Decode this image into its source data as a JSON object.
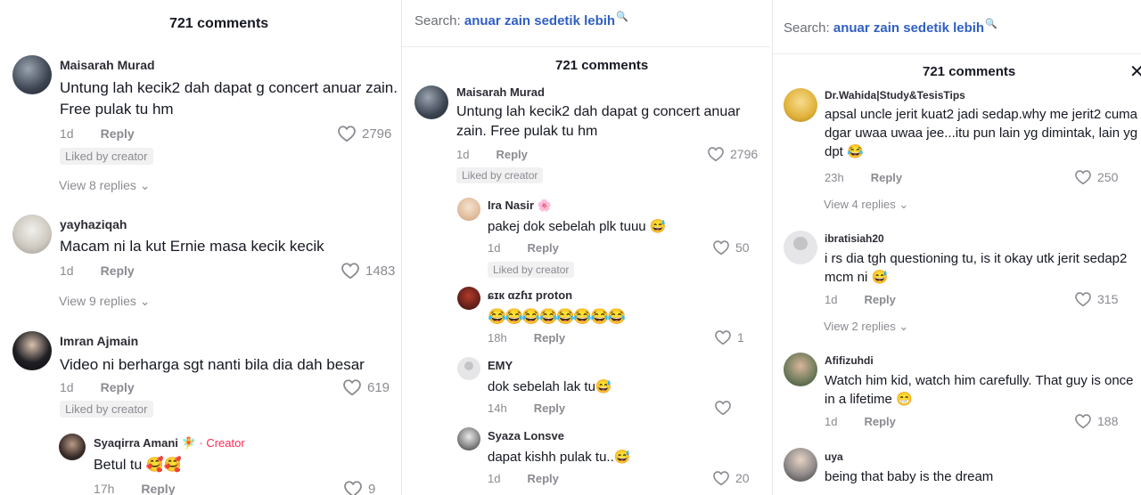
{
  "panel1": {
    "title": "721 comments",
    "comments": [
      {
        "user": "Maisarah Murad",
        "text": "Untung lah kecik2 dah dapat g concert anuar zain. Free pulak tu hm",
        "time": "1d",
        "reply": "Reply",
        "likes": "2796",
        "liked": "Liked by creator",
        "replies": "View 8 replies"
      },
      {
        "user": "yayhaziqah",
        "text": "Macam ni la kut Ernie masa kecik kecik",
        "time": "1d",
        "reply": "Reply",
        "likes": "1483",
        "replies": "View 9 replies"
      },
      {
        "user": "Imran Ajmain",
        "text": "Video ni berharga sgt nanti bila dia dah besar",
        "time": "1d",
        "reply": "Reply",
        "likes": "619",
        "liked": "Liked by creator"
      },
      {
        "user": "Syaqirra Amani",
        "user_emoji": "🧚",
        "dot": "·",
        "badge": "Creator",
        "text": "Betul tu 🥰🥰",
        "time": "17h",
        "reply": "Reply",
        "likes": "9"
      }
    ]
  },
  "panel2": {
    "search_label": "Search:",
    "search_query": "anuar zain sedetik lebih",
    "search_icon": "🔍",
    "title": "721 comments",
    "comments": [
      {
        "user": "Maisarah Murad",
        "text": "Untung lah kecik2 dah dapat g concert anuar zain. Free pulak tu hm",
        "time": "1d",
        "reply": "Reply",
        "likes": "2796",
        "liked": "Liked by creator"
      },
      {
        "user": "Ira Nasir 🌸",
        "text": "pakej dok sebelah plk tuuu 😅",
        "time": "1d",
        "reply": "Reply",
        "likes": "50",
        "liked": "Liked by creator"
      },
      {
        "user": "ɕɪк αzɦɪ proton",
        "text": "😂😂😂😂😂😂😂😂",
        "time": "18h",
        "reply": "Reply",
        "likes": "1"
      },
      {
        "user": "EMY",
        "text": "dok sebelah lak tu😅",
        "time": "14h",
        "reply": "Reply",
        "likes": ""
      },
      {
        "user": "Syaza Lonsve",
        "text": "dapat kishh pulak tu..😅",
        "time": "1d",
        "reply": "Reply",
        "likes": "20"
      }
    ]
  },
  "panel3": {
    "search_label": "Search:",
    "search_query": "anuar zain sedetik lebih",
    "search_icon": "🔍",
    "title": "721 comments",
    "close": "✕",
    "comments": [
      {
        "user": "Dr.Wahida|Study&TesisTips",
        "text": "apsal uncle jerit kuat2 jadi sedap.why me jerit2 cuma dgar uwaa uwaa jee...itu pun lain yg dimintak, lain yg dpt 😂",
        "time": "23h",
        "reply": "Reply",
        "likes": "250",
        "replies": "View 4 replies"
      },
      {
        "user": "ibratisiah20",
        "text": "i rs dia tgh questioning tu, is it okay utk jerit sedap2 mcm ni 😅",
        "time": "1d",
        "reply": "Reply",
        "likes": "315",
        "replies": "View 2 replies"
      },
      {
        "user": "Afifizuhdi",
        "text": "Watch him kid, watch him carefully. That guy is once in a lifetime 😁",
        "time": "1d",
        "reply": "Reply",
        "likes": "188"
      },
      {
        "user": "uya",
        "text": "being that baby is the dream"
      }
    ]
  },
  "colors": {
    "accent_blue": "#2f5fc4",
    "creator_red": "#fe2c55",
    "meta_gray": "#8a8b91"
  }
}
